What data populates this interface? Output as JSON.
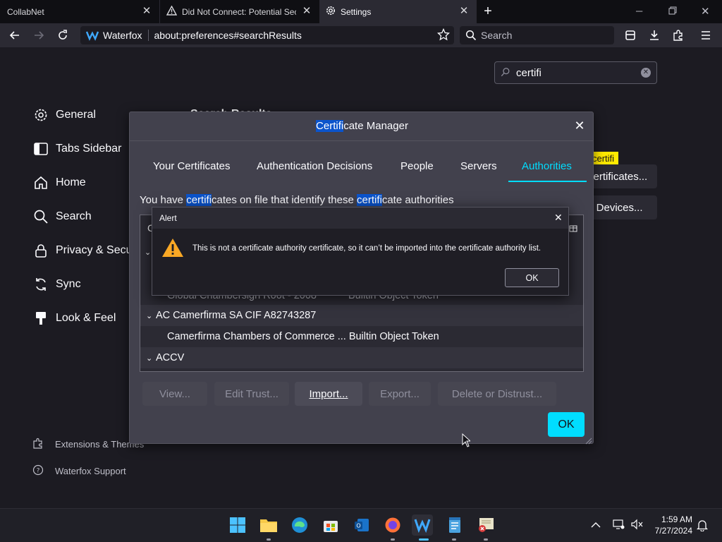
{
  "tabs": [
    {
      "label": "CollabNet"
    },
    {
      "label": "Did Not Connect: Potential Sec"
    },
    {
      "label": "Settings"
    }
  ],
  "nav": {
    "browser_name": "Waterfox",
    "url": "about:preferences#searchResults",
    "search_placeholder": "Search"
  },
  "prefs": {
    "search_value": "certifi",
    "sidebar": [
      {
        "label": "General",
        "icon": "gear-icon"
      },
      {
        "label": "Tabs Sidebar",
        "icon": "sidebar-icon"
      },
      {
        "label": "Home",
        "icon": "home-icon"
      },
      {
        "label": "Search",
        "icon": "search-icon"
      },
      {
        "label": "Privacy & Secu",
        "icon": "lock-icon"
      },
      {
        "label": "Sync",
        "icon": "sync-icon"
      },
      {
        "label": "Look & Feel",
        "icon": "brush-icon"
      }
    ],
    "footer_links": [
      {
        "label": "Extensions & Themes",
        "icon": "puzzle-icon"
      },
      {
        "label": "Waterfox Support",
        "icon": "help-icon"
      }
    ],
    "bg_results_header": "Search Results",
    "bg_tooltip": "certifi",
    "bg_view_certificates": "certificates...",
    "bg_security_devices": "y Devices..."
  },
  "cert_manager": {
    "title_hl": "Certifi",
    "title_rest": "cate Manager",
    "tabs": [
      {
        "label": "Your Certificates"
      },
      {
        "label": "Authentication Decisions"
      },
      {
        "label": "People"
      },
      {
        "label": "Servers"
      },
      {
        "label": "Authorities"
      }
    ],
    "desc_1": "You have ",
    "desc_hl1": "certifi",
    "desc_2": "cates on file that identify these ",
    "desc_hl2": "certifi",
    "desc_3": "cate authorities",
    "column_header_initial": "C",
    "rows": [
      {
        "kind": "partial",
        "name": "Global Chambersign Root - 2008",
        "token": "Builtin Object Token"
      },
      {
        "kind": "group",
        "name": "AC Camerfirma SA CIF A82743287"
      },
      {
        "kind": "item",
        "name": "Camerfirma Chambers of Commerce ...",
        "token": "Builtin Object Token"
      },
      {
        "kind": "group",
        "name": "ACCV"
      }
    ],
    "buttons": {
      "view": "View...",
      "edit_trust": "Edit Trust...",
      "import": "Import...",
      "export": "Export...",
      "delete": "Delete or Distrust..."
    },
    "ok": "OK"
  },
  "alert": {
    "title": "Alert",
    "message": "This is not a certificate authority certificate, so it can’t be imported into the certificate authority list.",
    "ok": "OK"
  },
  "taskbar": {
    "time": "1:59 AM",
    "date": "7/27/2024"
  },
  "colors": {
    "accent": "#00ddff",
    "highlight": "#0b54cc",
    "warning": "#f9a825"
  }
}
